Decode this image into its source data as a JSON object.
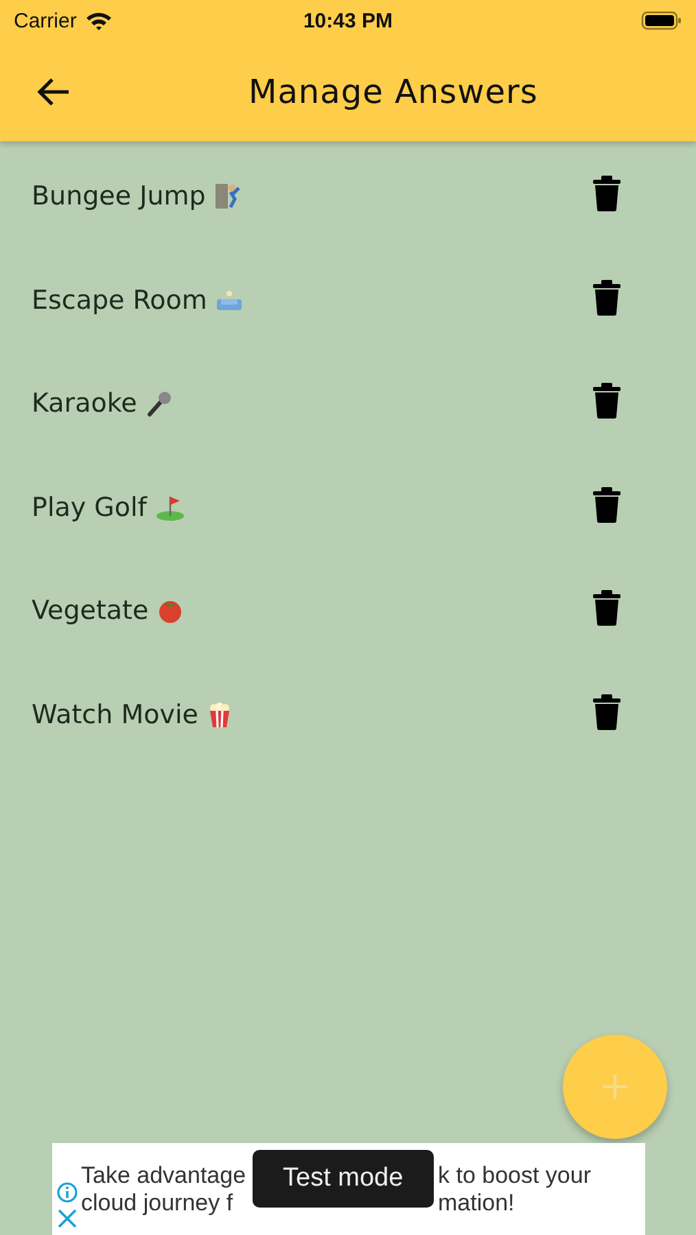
{
  "status_bar": {
    "carrier": "Carrier",
    "time": "10:43 PM"
  },
  "app_bar": {
    "title": "Manage Answers"
  },
  "answers": [
    {
      "label": "Bungee Jump",
      "kind": "climber"
    },
    {
      "label": "Escape Room",
      "kind": "couch"
    },
    {
      "label": "Karaoke",
      "kind": "microphone"
    },
    {
      "label": "Play Golf",
      "kind": "flag"
    },
    {
      "label": "Vegetate",
      "kind": "tomato"
    },
    {
      "label": "Watch Movie",
      "kind": "popcorn"
    }
  ],
  "ad": {
    "line_1": [
      "Take advantage",
      "k to boost your"
    ],
    "line_2": [
      "cloud journey f",
      "mation!"
    ]
  },
  "toast": "Test mode"
}
